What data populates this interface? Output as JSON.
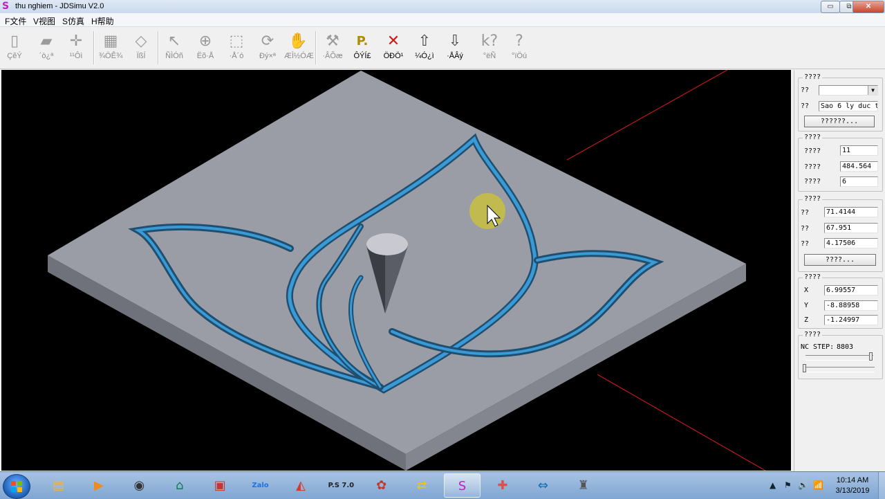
{
  "window": {
    "title": "thu nghiem - JDSimu V2.0",
    "app_icon_glyph": "S",
    "controls": {
      "minimize": "▭",
      "restore": "⧉",
      "close": "✕"
    }
  },
  "menu": [
    "F文件",
    "V视图",
    "S仿真",
    "H帮助"
  ],
  "toolbar": [
    {
      "label": "ÇĕÝ",
      "icon": "new-file-icon",
      "glyph": "▯",
      "enabled": false
    },
    {
      "label": "´ò¿ª",
      "icon": "open-folder-icon",
      "glyph": "▰",
      "enabled": false
    },
    {
      "label": "¹¹Ôì",
      "icon": "crosshair-plus-icon",
      "glyph": "✛",
      "enabled": false
    },
    {
      "label": "¾ÖÊ¾",
      "icon": "block-icon",
      "glyph": "▦",
      "enabled": false
    },
    {
      "label": "ÏßÍ",
      "icon": "cube-icon",
      "glyph": "◇",
      "enabled": false
    },
    {
      "label": "ÑÌÓñ",
      "icon": "pointer-icon",
      "glyph": "↖",
      "enabled": false
    },
    {
      "label": "Ëõ·Å",
      "icon": "zoom-icon",
      "glyph": "⊕",
      "enabled": false
    },
    {
      "label": "·Å´ó",
      "icon": "select-area-icon",
      "glyph": "⬚",
      "enabled": false
    },
    {
      "label": "Ðý×ª",
      "icon": "rotate-icon",
      "glyph": "⟳",
      "enabled": false
    },
    {
      "label": "ÆÌ½ÓÆ",
      "icon": "pan-hand-icon",
      "glyph": "✋",
      "enabled": false
    },
    {
      "label": "·ÂÕæ",
      "icon": "simulate-icon",
      "glyph": "⚒",
      "enabled": false
    },
    {
      "label": "ÔÝÍ£",
      "icon": "pause-icon",
      "glyph": "P.",
      "enabled": true
    },
    {
      "label": "ÖÐÖ¹",
      "icon": "stop-icon",
      "glyph": "✕",
      "enabled": true
    },
    {
      "label": "¼Ó¿ì",
      "icon": "speed-up-icon",
      "glyph": "⇧",
      "enabled": true
    },
    {
      "label": "·ÅÂý",
      "icon": "slow-down-icon",
      "glyph": "⇩",
      "enabled": true
    },
    {
      "label": "°ëÑ",
      "icon": "whats-this-icon",
      "glyph": "k?",
      "enabled": false
    },
    {
      "label": "°ïÖú",
      "icon": "help-icon",
      "glyph": "?",
      "enabled": false
    }
  ],
  "panel": {
    "tool_group": {
      "title": "????",
      "type_label": "??",
      "type_value": "",
      "name_label": "??",
      "name_value": "Sao 6 ly duc t",
      "button": "??????..."
    },
    "machining_group": {
      "title": "????",
      "rows": [
        {
          "label": "????",
          "value": "11"
        },
        {
          "label": "????",
          "value": "484.564"
        },
        {
          "label": "????",
          "value": "6"
        }
      ]
    },
    "size_group": {
      "title": "????",
      "rows": [
        {
          "label": "??",
          "value": "71.4144"
        },
        {
          "label": "??",
          "value": "67.951"
        },
        {
          "label": "??",
          "value": "4.17506"
        }
      ],
      "button": "????..."
    },
    "position_group": {
      "title": "????",
      "rows": [
        {
          "label": "X",
          "value": "6.99557"
        },
        {
          "label": "Y",
          "value": "-8.88958"
        },
        {
          "label": "Z",
          "value": "-1.24997"
        }
      ]
    },
    "nc_group": {
      "title": "????",
      "nc_step_label": "NC STEP:",
      "nc_step_value": "8803",
      "progress_fraction": 0.98,
      "speed_fraction": 0.0
    }
  },
  "taskbar": {
    "apps": [
      {
        "name": "explorer",
        "glyph": "▤",
        "color": "#e8b64a"
      },
      {
        "name": "media-player",
        "glyph": "▶",
        "color": "#f08a1c"
      },
      {
        "name": "camera",
        "glyph": "◉",
        "color": "#333333"
      },
      {
        "name": "house-app",
        "glyph": "⌂",
        "color": "#0f7d4f"
      },
      {
        "name": "network-app",
        "glyph": "▣",
        "color": "#c0392b"
      },
      {
        "name": "zalo",
        "glyph": "Zalo",
        "color": "#1a73e8"
      },
      {
        "name": "chrome-like",
        "glyph": "◭",
        "color": "#d33a2c"
      },
      {
        "name": "ps7",
        "glyph": "P.S 7.0",
        "color": "#222222"
      },
      {
        "name": "artcam",
        "glyph": "✿",
        "color": "#c0392b"
      },
      {
        "name": "sync-app",
        "glyph": "⇄",
        "color": "#f1c40f"
      },
      {
        "name": "jdsimu",
        "glyph": "S",
        "color": "#c21dc4"
      },
      {
        "name": "shield-app",
        "glyph": "✚",
        "color": "#e74c3c"
      },
      {
        "name": "teamviewer",
        "glyph": "⇔",
        "color": "#0e6eb8"
      },
      {
        "name": "machine-app",
        "glyph": "♜",
        "color": "#555555"
      }
    ],
    "active_index": 10,
    "tray_icons": [
      "▲",
      "⚑",
      "🔊",
      "📶"
    ],
    "time": "10:14 AM",
    "date": "3/13/2019"
  },
  "colors": {
    "viewport_bg": "#000000",
    "plate_top": "#9a9ca6",
    "groove": "#3a9ad6",
    "axis_line": "#c01818",
    "cursor_halo": "#c8c040"
  }
}
